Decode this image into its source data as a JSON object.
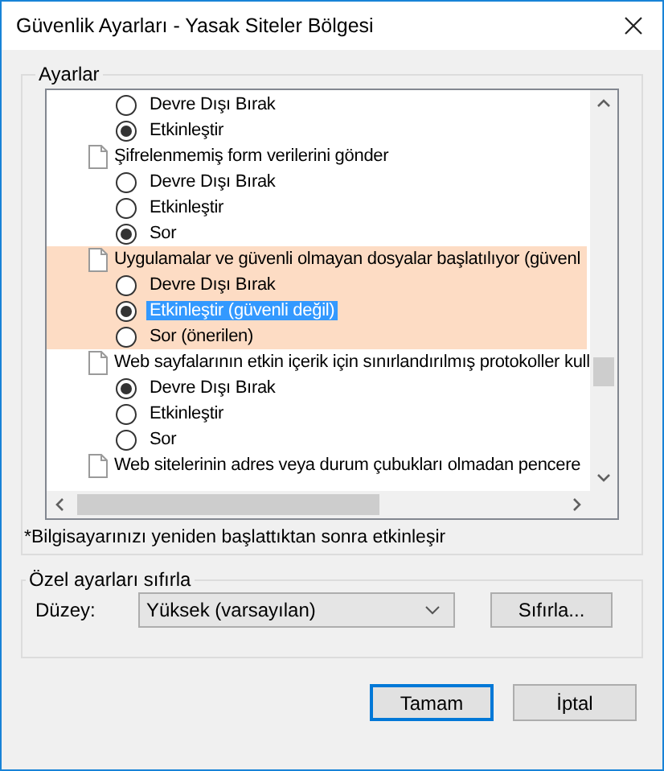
{
  "window": {
    "title": "Güvenlik Ayarları - Yasak Siteler Bölgesi"
  },
  "settings_group": {
    "title": "Ayarlar",
    "rows": [
      {
        "kind": "option",
        "label": "Devre Dışı Bırak",
        "checked": false,
        "highlighted": false,
        "selected": false
      },
      {
        "kind": "option",
        "label": "Etkinleştir",
        "checked": true,
        "highlighted": false,
        "selected": false
      },
      {
        "kind": "setting",
        "label": "Şifrelenmemiş form verilerini gönder",
        "highlighted": false
      },
      {
        "kind": "option",
        "label": "Devre Dışı Bırak",
        "checked": false,
        "highlighted": false,
        "selected": false
      },
      {
        "kind": "option",
        "label": "Etkinleştir",
        "checked": false,
        "highlighted": false,
        "selected": false
      },
      {
        "kind": "option",
        "label": "Sor",
        "checked": true,
        "highlighted": false,
        "selected": false
      },
      {
        "kind": "setting",
        "label": "Uygulamalar ve güvenli olmayan dosyalar başlatılıyor (güvenl",
        "highlighted": true
      },
      {
        "kind": "option",
        "label": "Devre Dışı Bırak",
        "checked": false,
        "highlighted": true,
        "selected": false
      },
      {
        "kind": "option",
        "label": "Etkinleştir (güvenli değil)",
        "checked": true,
        "highlighted": true,
        "selected": true
      },
      {
        "kind": "option",
        "label": "Sor (önerilen)",
        "checked": false,
        "highlighted": true,
        "selected": false
      },
      {
        "kind": "setting",
        "label": "Web sayfalarının etkin içerik için sınırlandırılmış protokoller kull",
        "highlighted": false
      },
      {
        "kind": "option",
        "label": "Devre Dışı Bırak",
        "checked": true,
        "highlighted": false,
        "selected": false
      },
      {
        "kind": "option",
        "label": "Etkinleştir",
        "checked": false,
        "highlighted": false,
        "selected": false
      },
      {
        "kind": "option",
        "label": "Sor",
        "checked": false,
        "highlighted": false,
        "selected": false
      },
      {
        "kind": "setting",
        "label": "Web sitelerinin adres veya durum çubukları olmadan pencere",
        "highlighted": false
      }
    ],
    "note": "*Bilgisayarınızı yeniden başlattıktan sonra etkinleşir"
  },
  "reset_group": {
    "title": "Özel ayarları sıfırla",
    "level_label": "Düzey:",
    "level_value": "Yüksek (varsayılan)",
    "reset_button": "Sıfırla..."
  },
  "buttons": [
    {
      "label": "Tamam",
      "default": true
    },
    {
      "label": "İptal",
      "default": false
    }
  ]
}
